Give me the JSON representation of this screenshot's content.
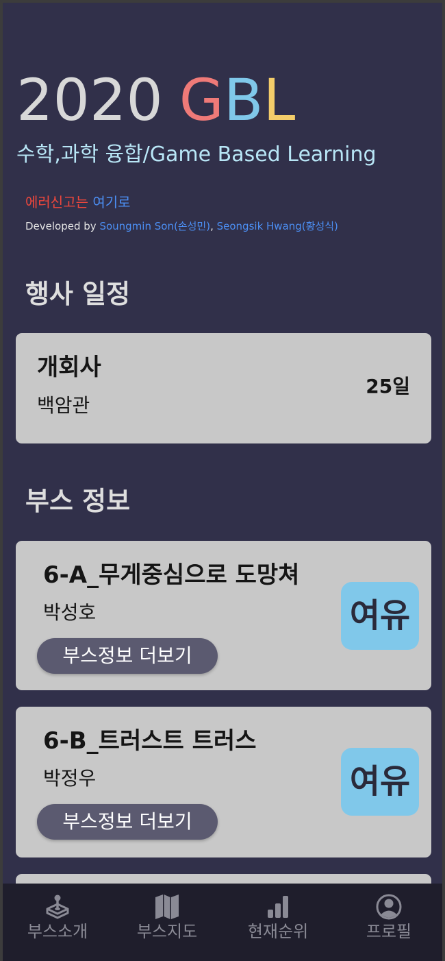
{
  "header": {
    "title_year": "2020",
    "title_g": "G",
    "title_b": "B",
    "title_l": "L",
    "subtitle": "수학,과학 융합/Game Based Learning",
    "report_prefix": "에러신고는",
    "report_link": "여기로",
    "dev_prefix": "Developed by",
    "dev_name_1": "Soungmin Son(손성민)",
    "dev_sep": ",",
    "dev_name_2": "Seongsik Hwang(황성식)"
  },
  "colors": {
    "background": "#31304a",
    "card": "#c8c8c8",
    "title_g": "#ef7a78",
    "title_b": "#80c8ea",
    "title_l": "#f4cd6a",
    "subtitle": "#b8e6f6",
    "report_red": "#f0473c",
    "link_blue": "#4c8ff4",
    "badge": "#80c8ea",
    "button": "#5b5a70",
    "tabbar": "#1f1e2c"
  },
  "schedule": {
    "section_title": "행사 일정",
    "event": {
      "name": "개회사",
      "place": "백암관",
      "date": "25일"
    }
  },
  "booths": {
    "section_title": "부스 정보",
    "items": [
      {
        "name": "6-A_무게중심으로 도망쳐",
        "host": "박성호",
        "button_label": "부스정보 더보기",
        "status": "여유"
      },
      {
        "name": "6-B_트러스트 트러스",
        "host": "박정우",
        "button_label": "부스정보 더보기",
        "status": "여유"
      }
    ]
  },
  "tabbar": {
    "items": [
      {
        "label": "부스소개",
        "icon": "joystick-icon"
      },
      {
        "label": "부스지도",
        "icon": "map-icon"
      },
      {
        "label": "현재순위",
        "icon": "bar-chart-icon"
      },
      {
        "label": "프로필",
        "icon": "user-circle-icon"
      }
    ]
  }
}
